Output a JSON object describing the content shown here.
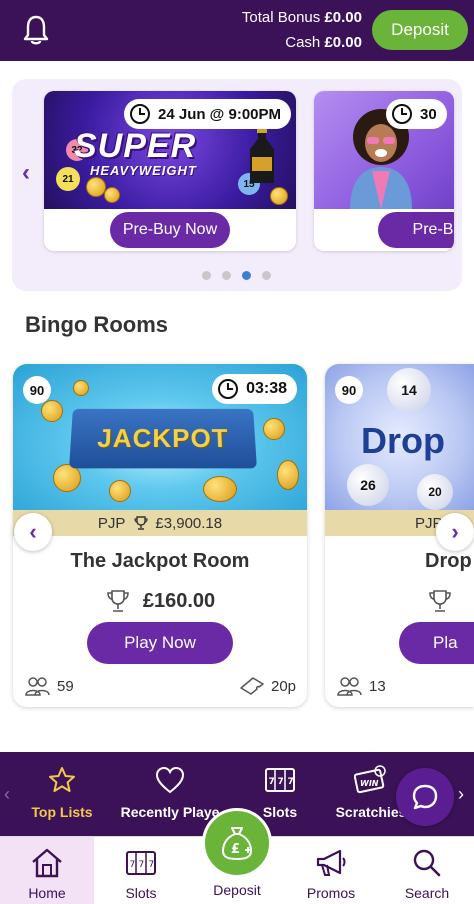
{
  "header": {
    "total_bonus_label": "Total Bonus",
    "total_bonus_value": "£0.00",
    "cash_label": "Cash",
    "cash_value": "£0.00",
    "deposit_label": "Deposit"
  },
  "promos": [
    {
      "time": "24 Jun @ 9:00PM",
      "title_line1": "SUPER",
      "title_line2": "HEAVYWEIGHT",
      "button": "Pre-Buy Now",
      "balls": [
        "32",
        "21",
        "15"
      ]
    },
    {
      "time": "30",
      "button": "Pre-B"
    }
  ],
  "promo_dots": {
    "count": 4,
    "active_index": 2
  },
  "section_title": "Bingo Rooms",
  "rooms": [
    {
      "badge": "90",
      "timer": "03:38",
      "image_text": "JACKPOT",
      "pjp_label": "PJP",
      "pjp_value": "£3,900.18",
      "name": "The Jackpot Room",
      "prize": "£160.00",
      "button": "Play Now",
      "players": "59",
      "ticket_price": "20p"
    },
    {
      "badge": "90",
      "image_text": "Drop",
      "pjp_label": "PJP",
      "name": "Drop",
      "button": "Pla",
      "players": "13",
      "balls": [
        "14",
        "26",
        "20"
      ]
    }
  ],
  "categories": [
    {
      "label": "Top Lists",
      "icon": "star-icon",
      "active": true
    },
    {
      "label": "Recently Playe",
      "icon": "heart-icon",
      "active": false
    },
    {
      "label": "Slots",
      "icon": "slot-machine-icon",
      "active": false
    },
    {
      "label": "Scratchies",
      "icon": "scratch-card-icon",
      "active": false
    }
  ],
  "bottom_nav": [
    {
      "label": "Home",
      "icon": "home-icon",
      "active": true
    },
    {
      "label": "Slots",
      "icon": "slot-machine-icon",
      "active": false
    },
    {
      "label": "Deposit",
      "icon": "money-bag-icon",
      "active": false
    },
    {
      "label": "Promos",
      "icon": "megaphone-icon",
      "active": false
    },
    {
      "label": "Search",
      "icon": "search-icon",
      "active": false
    }
  ],
  "colors": {
    "header_bg": "#3b1257",
    "primary_purple": "#6a2aa5",
    "deposit_green": "#6bb43a",
    "dot_active": "#3e7fd6",
    "active_category": "#f2c94c"
  }
}
